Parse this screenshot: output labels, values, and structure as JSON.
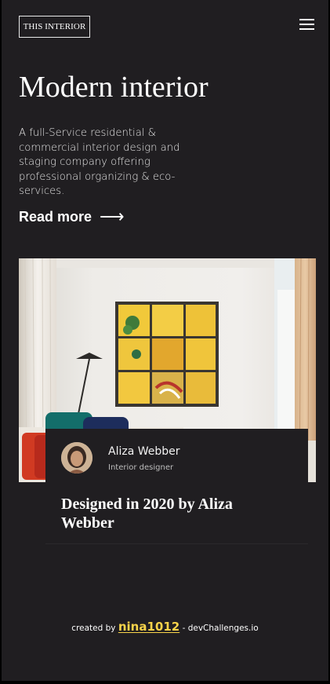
{
  "header": {
    "logo_text": "THIS INTERIOR",
    "menu_icon": "hamburger-menu-icon"
  },
  "hero": {
    "title": "Modern interior",
    "description": "A full-Service residential & commercial interior design and staging company offering professional organizing & eco-services.",
    "read_more_label": "Read more",
    "read_more_arrow": "⟶"
  },
  "feature": {
    "image_subject": "living room with yellow framed wall art, floor lamp and cushions",
    "author_name": "Aliza Webber",
    "author_role": "Interior designer",
    "title": "Designed in 2020 by Aliza Webber"
  },
  "footer": {
    "prefix": "created by",
    "handle": "nina1012",
    "suffix": "- devChallenges.io"
  },
  "colors": {
    "background": "#201e21",
    "text": "#ffffff",
    "accent": "#f7d34a"
  }
}
